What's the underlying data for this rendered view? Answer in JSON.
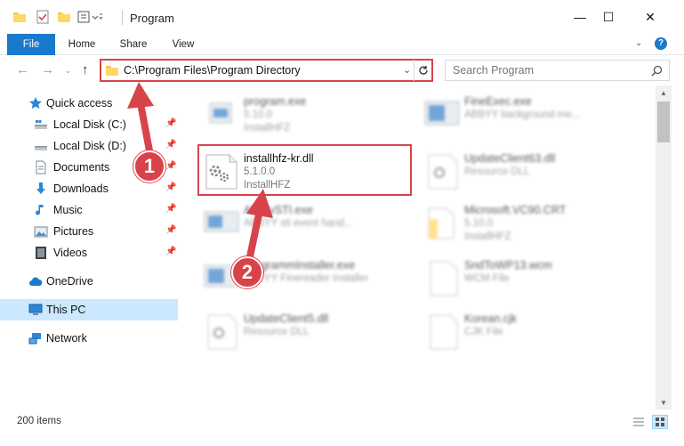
{
  "window": {
    "title": "Program",
    "minimize": "—",
    "maximize": "☐",
    "close": "✕"
  },
  "ribbon": {
    "tabs": [
      "File",
      "Home",
      "Share",
      "View"
    ],
    "help": "?"
  },
  "address": {
    "path": "C:\\Program Files\\Program Directory"
  },
  "search": {
    "placeholder": "Search Program"
  },
  "sidebar": {
    "quick_access": "Quick access",
    "items": [
      {
        "label": "Local Disk (C:)",
        "icon": "drive-icon"
      },
      {
        "label": "Local Disk (D:)",
        "icon": "drive-icon"
      },
      {
        "label": "Documents",
        "icon": "documents-icon"
      },
      {
        "label": "Downloads",
        "icon": "downloads-icon"
      },
      {
        "label": "Music",
        "icon": "music-icon"
      },
      {
        "label": "Pictures",
        "icon": "pictures-icon"
      },
      {
        "label": "Videos",
        "icon": "videos-icon"
      }
    ],
    "onedrive": "OneDrive",
    "thispc": "This PC",
    "network": "Network"
  },
  "files": {
    "left": [
      {
        "name": "program.exe",
        "line2": "5.10.0",
        "line3": "InstallHFZ"
      },
      {
        "name": "installhfz-kr.dll",
        "line2": "5.1.0.0",
        "line3": "InstallHFZ"
      },
      {
        "name": "AbbyySTI.exe",
        "line2": "ABBYY sti event hand...",
        "line3": ""
      },
      {
        "name": "ProgrammInstaller.exe",
        "line2": "ABBYY Finereader Installer",
        "line3": ""
      },
      {
        "name": "UpdateClient5.dll",
        "line2": "Resource DLL",
        "line3": ""
      }
    ],
    "right": [
      {
        "name": "FineExec.exe",
        "line2": "ABBYY background me...",
        "line3": ""
      },
      {
        "name": "UpdateClient63.dll",
        "line2": "Resource DLL",
        "line3": ""
      },
      {
        "name": "Microsoft.VC90.CRT",
        "line2": "5.10.0",
        "line3": "InstallHFZ"
      },
      {
        "name": "SndToWP13.wcm",
        "line2": "WCM File",
        "line3": ""
      },
      {
        "name": "Korean.cjk",
        "line2": "CJK File",
        "line3": ""
      }
    ]
  },
  "status": {
    "count": "200 items"
  },
  "annotations": {
    "step1": "1",
    "step2": "2"
  },
  "colors": {
    "accent": "#1979ca",
    "highlight": "#d8434a",
    "selected": "#cce8ff"
  }
}
